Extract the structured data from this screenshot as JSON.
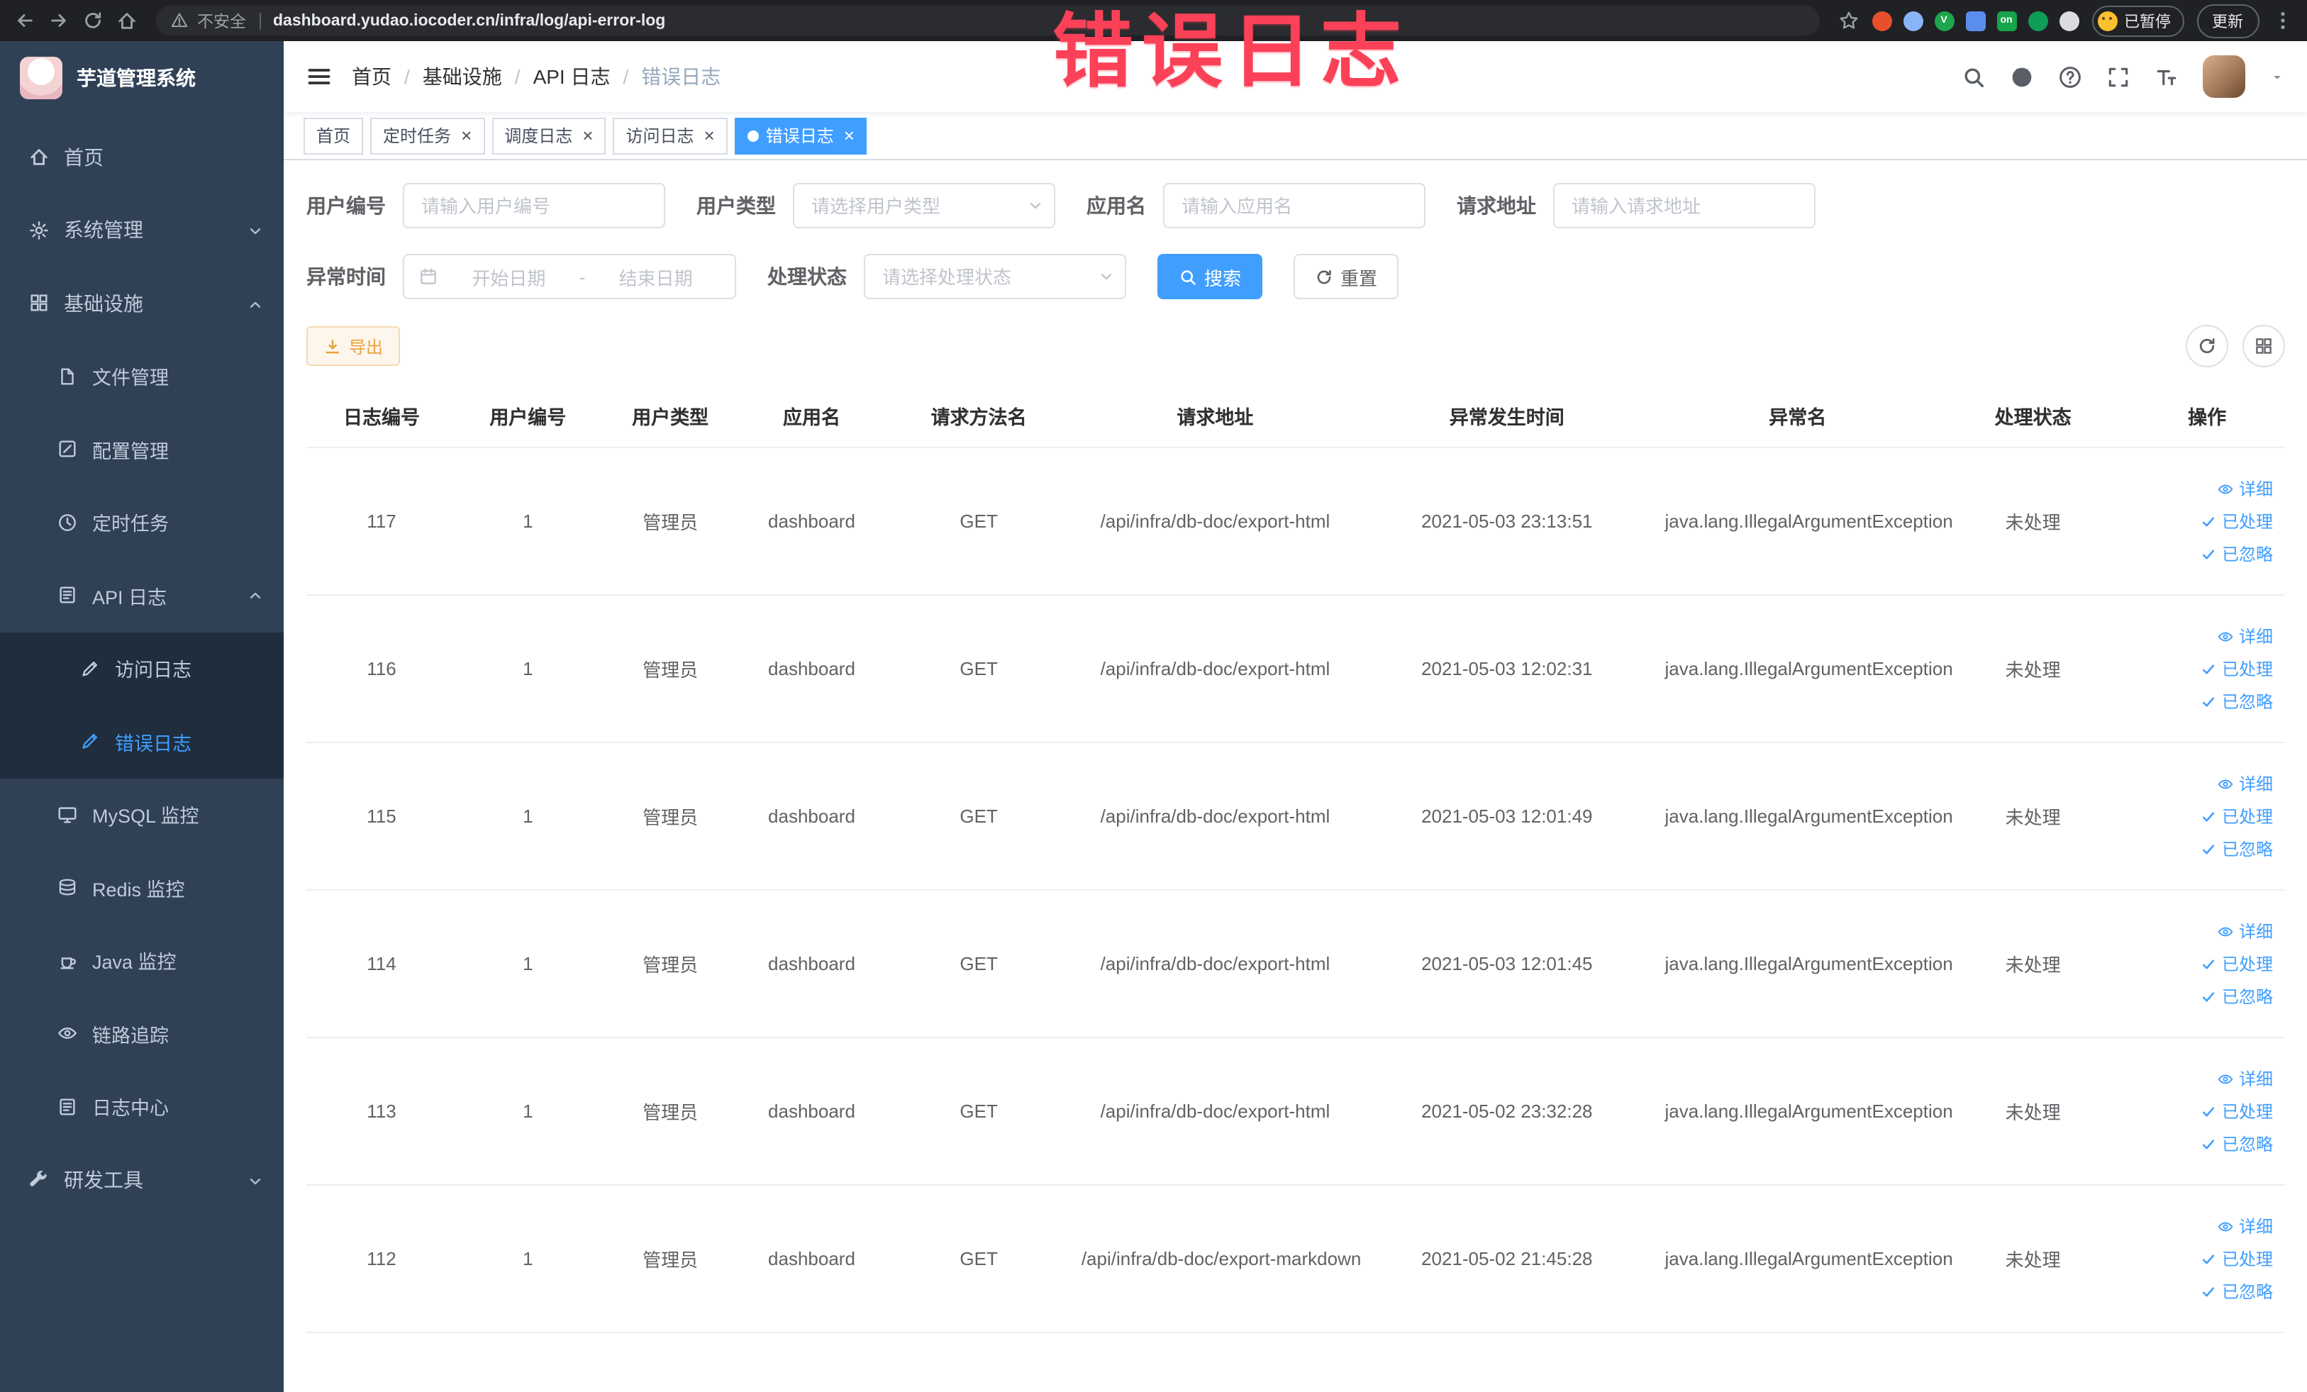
{
  "browser": {
    "security_label": "不安全",
    "url": "dashboard.yudao.iocoder.cn/infra/log/api-error-log",
    "paused_badge": "已暂停",
    "update_button": "更新",
    "extensions": [
      {
        "name": "extension-orange-icon",
        "color": "#e8502c",
        "shape": "circle",
        "label": ""
      },
      {
        "name": "extension-drop-icon",
        "color": "#8ab4f8",
        "shape": "circle",
        "label": ""
      },
      {
        "name": "extension-v-icon",
        "color": "#1fa54d",
        "shape": "circle",
        "label": "V"
      },
      {
        "name": "extension-grid-icon",
        "color": "#5b8def",
        "shape": "square",
        "label": ""
      },
      {
        "name": "extension-on-icon",
        "color": "#16a34a",
        "shape": "square",
        "label": "on"
      },
      {
        "name": "extension-leaf-icon",
        "color": "#0f9d58",
        "shape": "circle",
        "label": ""
      },
      {
        "name": "extension-paw-icon",
        "color": "#dadce0",
        "shape": "circle",
        "label": ""
      }
    ]
  },
  "annotation": {
    "text": "错误日志"
  },
  "sidebar": {
    "logo_title": "芋道管理系统",
    "items": [
      {
        "label": "首页",
        "icon": "home-icon",
        "level": 1
      },
      {
        "label": "系统管理",
        "icon": "gear-icon",
        "level": 1,
        "arrow": "down"
      },
      {
        "label": "基础设施",
        "icon": "grid-icon",
        "level": 1,
        "arrow": "up"
      },
      {
        "label": "文件管理",
        "icon": "file-icon",
        "level": 2
      },
      {
        "label": "配置管理",
        "icon": "config-icon",
        "level": 2
      },
      {
        "label": "定时任务",
        "icon": "job-icon",
        "level": 2
      },
      {
        "label": "API 日志",
        "icon": "log-icon",
        "level": 2,
        "arrow": "up"
      },
      {
        "label": "访问日志",
        "icon": "edit-icon",
        "level": 3
      },
      {
        "label": "错误日志",
        "icon": "edit-icon",
        "level": 3,
        "active": true
      },
      {
        "label": "MySQL 监控",
        "icon": "monitor-icon",
        "level": 2
      },
      {
        "label": "Redis 监控",
        "icon": "redis-icon",
        "level": 2
      },
      {
        "label": "Java 监控",
        "icon": "java-icon",
        "level": 2
      },
      {
        "label": "链路追踪",
        "icon": "eye-icon",
        "level": 2
      },
      {
        "label": "日志中心",
        "icon": "log-icon",
        "level": 2
      },
      {
        "label": "研发工具",
        "icon": "tool-icon",
        "level": 1,
        "arrow": "down"
      }
    ]
  },
  "header": {
    "breadcrumb": [
      "首页",
      "基础设施",
      "API 日志",
      "错误日志"
    ],
    "separator": "/"
  },
  "tabs": [
    {
      "label": "首页",
      "closable": false,
      "active": false
    },
    {
      "label": "定时任务",
      "closable": true,
      "active": false
    },
    {
      "label": "调度日志",
      "closable": true,
      "active": false
    },
    {
      "label": "访问日志",
      "closable": true,
      "active": false
    },
    {
      "label": "错误日志",
      "closable": true,
      "active": true
    }
  ],
  "filters": {
    "user_id": {
      "label": "用户编号",
      "placeholder": "请输入用户编号"
    },
    "user_type": {
      "label": "用户类型",
      "placeholder": "请选择用户类型"
    },
    "app_name": {
      "label": "应用名",
      "placeholder": "请输入应用名"
    },
    "request_url": {
      "label": "请求地址",
      "placeholder": "请输入请求地址"
    },
    "exception_time": {
      "label": "异常时间",
      "start_placeholder": "开始日期",
      "separator": "-",
      "end_placeholder": "结束日期"
    },
    "process_status": {
      "label": "处理状态",
      "placeholder": "请选择处理状态"
    },
    "search_label": "搜索",
    "reset_label": "重置"
  },
  "toolbar": {
    "export_label": "导出"
  },
  "table": {
    "columns": [
      "日志编号",
      "用户编号",
      "用户类型",
      "应用名",
      "请求方法名",
      "请求地址",
      "异常发生时间",
      "异常名",
      "处理状态",
      "操作"
    ],
    "actions": [
      "详细",
      "已处理",
      "已忽略"
    ],
    "rows": [
      {
        "id": "117",
        "user_id": "1",
        "user_type": "管理员",
        "app": "dashboard",
        "method": "GET",
        "url": "/api/infra/db-doc/export-html",
        "time": "2021-05-03 23:13:51",
        "exception": "java.lang.IllegalArgumentException",
        "status": "未处理"
      },
      {
        "id": "116",
        "user_id": "1",
        "user_type": "管理员",
        "app": "dashboard",
        "method": "GET",
        "url": "/api/infra/db-doc/export-html",
        "time": "2021-05-03 12:02:31",
        "exception": "java.lang.IllegalArgumentException",
        "status": "未处理"
      },
      {
        "id": "115",
        "user_id": "1",
        "user_type": "管理员",
        "app": "dashboard",
        "method": "GET",
        "url": "/api/infra/db-doc/export-html",
        "time": "2021-05-03 12:01:49",
        "exception": "java.lang.IllegalArgumentException",
        "status": "未处理"
      },
      {
        "id": "114",
        "user_id": "1",
        "user_type": "管理员",
        "app": "dashboard",
        "method": "GET",
        "url": "/api/infra/db-doc/export-html",
        "time": "2021-05-03 12:01:45",
        "exception": "java.lang.IllegalArgumentException",
        "status": "未处理"
      },
      {
        "id": "113",
        "user_id": "1",
        "user_type": "管理员",
        "app": "dashboard",
        "method": "GET",
        "url": "/api/infra/db-doc/export-html",
        "time": "2021-05-02 23:32:28",
        "exception": "java.lang.IllegalArgumentException",
        "status": "未处理"
      },
      {
        "id": "112",
        "user_id": "1",
        "user_type": "管理员",
        "app": "dashboard",
        "method": "GET",
        "url": "/api/infra/db-doc/export-markdown",
        "time": "2021-05-02 21:45:28",
        "exception": "java.lang.IllegalArgumentException",
        "status": "未处理"
      }
    ]
  },
  "colors": {
    "primary": "#409eff",
    "sidebar_bg": "#304156",
    "warning": "#e6a23c",
    "annotation": "#fb4158"
  }
}
